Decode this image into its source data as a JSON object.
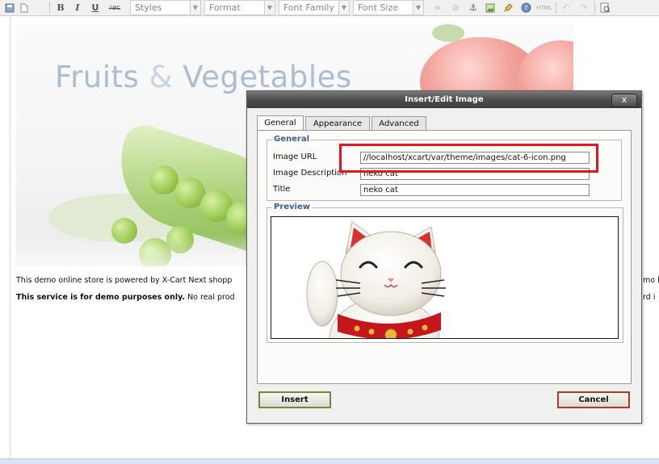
{
  "toolbar": {
    "buttons": {
      "save": "save-icon",
      "new_document": "new-document-icon",
      "bold": "B",
      "italic": "I",
      "underline": "U",
      "strikethrough": "ABC"
    },
    "selects": {
      "styles": "Styles",
      "format": "Format",
      "font_family": "Font Family",
      "font_size": "Font Size"
    },
    "icons": [
      "link-icon",
      "unlink-icon",
      "anchor-icon",
      "image-icon",
      "cleanup-icon",
      "help-icon",
      "html-icon",
      "undo-icon",
      "redo-icon",
      "preview-icon"
    ],
    "html_label": "HTML"
  },
  "editor": {
    "banner": {
      "title_part1": "Fruits",
      "title_amp": "&",
      "title_part2": "Vegetables"
    },
    "paragraph1": "This demo online store is powered by X-Cart Next shopp",
    "paragraph1_right": "mo h",
    "paragraph2_bold": "This service is for demo purposes only.",
    "paragraph2_rest": " No real prod",
    "paragraph2_right": "rd i"
  },
  "dialog": {
    "title": "Insert/Edit Image",
    "close_glyph": "x",
    "tabs": [
      {
        "label": "General",
        "active": true
      },
      {
        "label": "Appearance",
        "active": false
      },
      {
        "label": "Advanced",
        "active": false
      }
    ],
    "general_legend": "General",
    "fields": {
      "image_url": {
        "label": "Image URL",
        "value": "//localhost/xcart/var/theme/images/cat-6-icon.png"
      },
      "image_description": {
        "label": "Image Description",
        "value": "neko cat"
      },
      "title": {
        "label": "Title",
        "value": "neko cat"
      }
    },
    "preview_legend": "Preview",
    "buttons": {
      "insert": "Insert",
      "cancel": "Cancel"
    },
    "highlight_color": "#e8141b"
  }
}
